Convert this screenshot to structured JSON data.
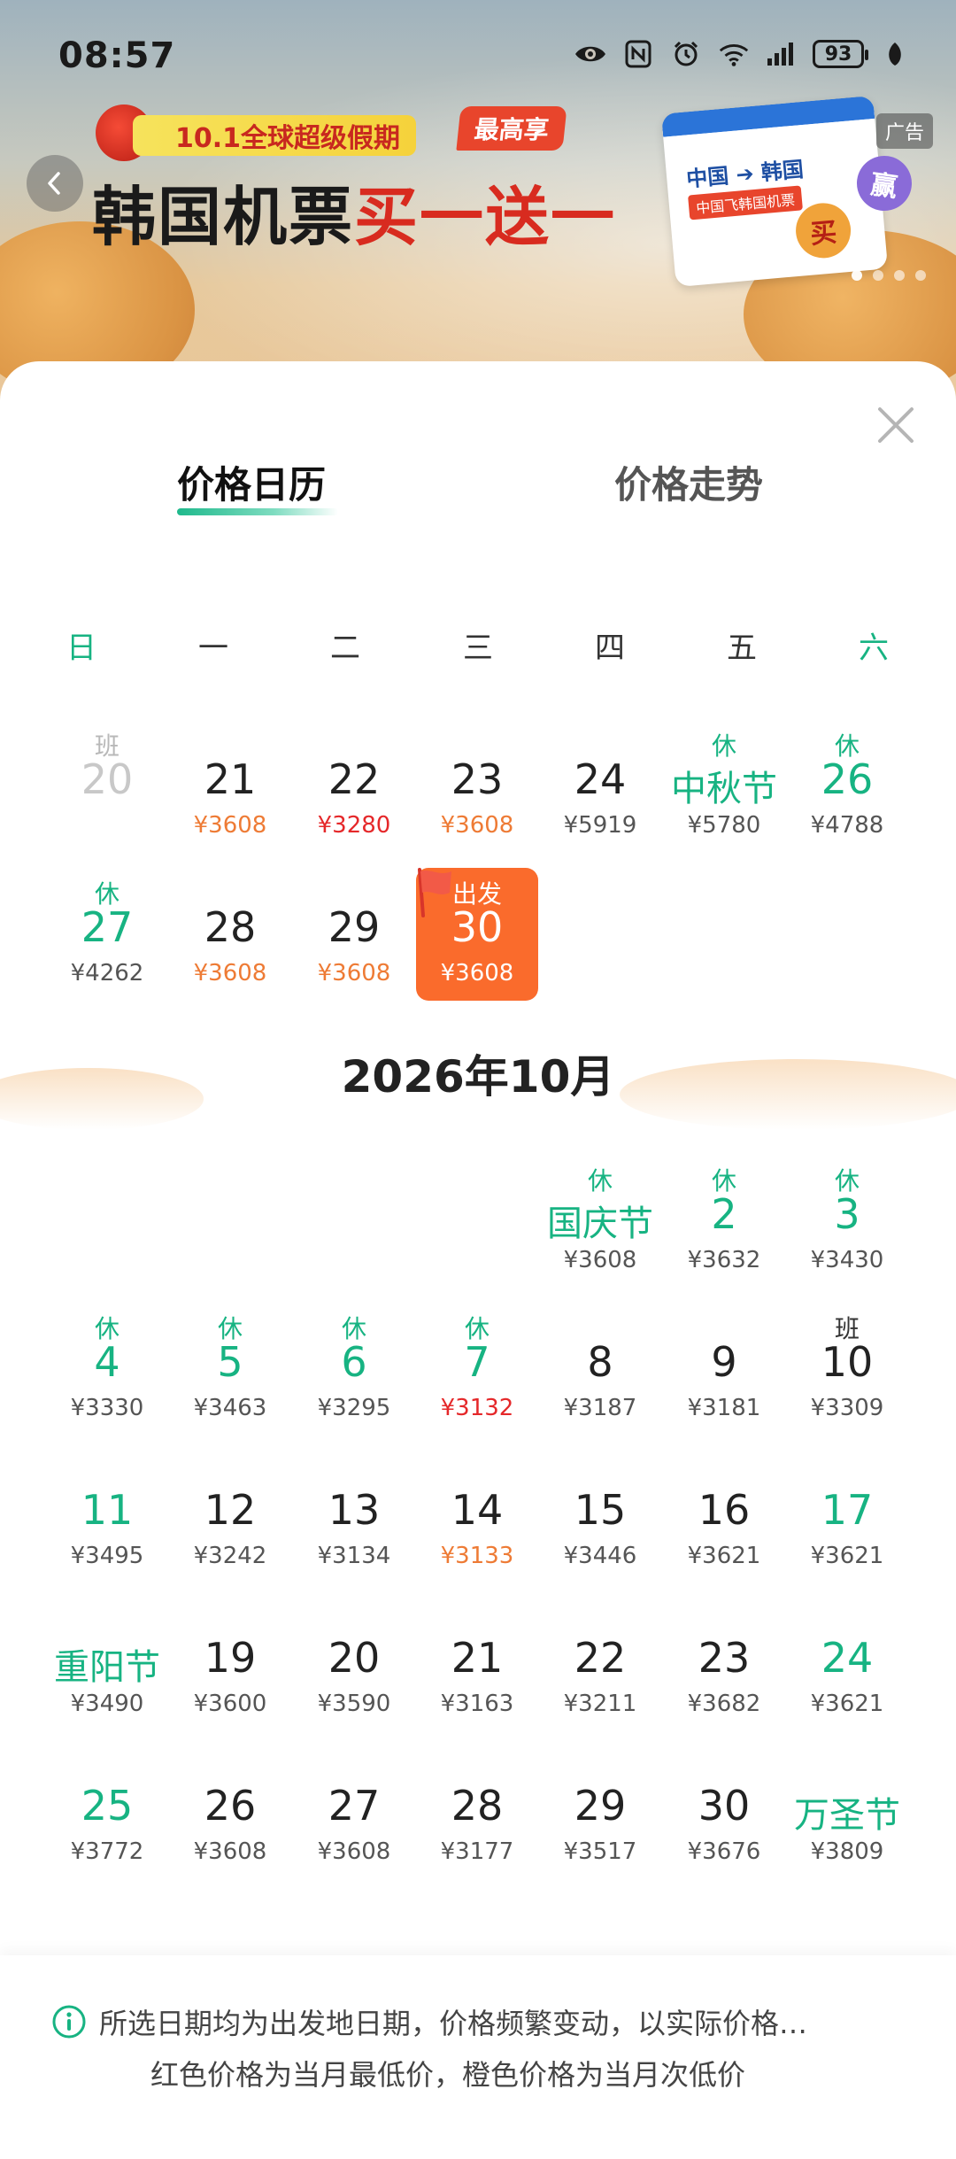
{
  "status_bar": {
    "time": "08:57",
    "battery": "93",
    "icons": [
      "eye-icon",
      "nfc-icon",
      "alarm-icon",
      "wifi-6-icon",
      "signal-icon",
      "leaf-icon"
    ]
  },
  "banner": {
    "promo_tag": "10.1全球超级假期",
    "title_black": "韩国机票",
    "title_red": "买一送一",
    "max_tag": "最高享",
    "ticket_route": "中国 ➔ 韩国",
    "ticket_sub": "中国飞韩国机票",
    "ticket_buy": "买",
    "ticket_win": "赢",
    "ad_label": "广告"
  },
  "tabs": {
    "calendar": "价格日历",
    "trend": "价格走势"
  },
  "weekdays": [
    "日",
    "一",
    "二",
    "三",
    "四",
    "五",
    "六"
  ],
  "september": [
    {
      "tag": "班",
      "day": "20",
      "price": ""
    },
    {
      "tag": "",
      "day": "21",
      "price": "¥3608"
    },
    {
      "tag": "",
      "day": "22",
      "price": "¥3280"
    },
    {
      "tag": "",
      "day": "23",
      "price": "¥3608"
    },
    {
      "tag": "",
      "day": "24",
      "price": "¥5919"
    },
    {
      "tag": "休",
      "day": "中秋节",
      "price": "¥5780"
    },
    {
      "tag": "休",
      "day": "26",
      "price": "¥4788"
    },
    {
      "tag": "休",
      "day": "27",
      "price": "¥4262"
    },
    {
      "tag": "",
      "day": "28",
      "price": "¥3608"
    },
    {
      "tag": "",
      "day": "29",
      "price": "¥3608"
    },
    {
      "tag": "出发",
      "day": "30",
      "price": "¥3608"
    }
  ],
  "october_title": "2026年10月",
  "october": [
    {
      "tag": "休",
      "day": "国庆节",
      "price": "¥3608"
    },
    {
      "tag": "休",
      "day": "2",
      "price": "¥3632"
    },
    {
      "tag": "休",
      "day": "3",
      "price": "¥3430"
    },
    {
      "tag": "休",
      "day": "4",
      "price": "¥3330"
    },
    {
      "tag": "休",
      "day": "5",
      "price": "¥3463"
    },
    {
      "tag": "休",
      "day": "6",
      "price": "¥3295"
    },
    {
      "tag": "休",
      "day": "7",
      "price": "¥3132"
    },
    {
      "tag": "",
      "day": "8",
      "price": "¥3187"
    },
    {
      "tag": "",
      "day": "9",
      "price": "¥3181"
    },
    {
      "tag": "班",
      "day": "10",
      "price": "¥3309"
    },
    {
      "tag": "",
      "day": "11",
      "price": "¥3495"
    },
    {
      "tag": "",
      "day": "12",
      "price": "¥3242"
    },
    {
      "tag": "",
      "day": "13",
      "price": "¥3134"
    },
    {
      "tag": "",
      "day": "14",
      "price": "¥3133"
    },
    {
      "tag": "",
      "day": "15",
      "price": "¥3446"
    },
    {
      "tag": "",
      "day": "16",
      "price": "¥3621"
    },
    {
      "tag": "",
      "day": "17",
      "price": "¥3621"
    },
    {
      "tag": "",
      "day": "重阳节",
      "price": "¥3490"
    },
    {
      "tag": "",
      "day": "19",
      "price": "¥3600"
    },
    {
      "tag": "",
      "day": "20",
      "price": "¥3590"
    },
    {
      "tag": "",
      "day": "21",
      "price": "¥3163"
    },
    {
      "tag": "",
      "day": "22",
      "price": "¥3211"
    },
    {
      "tag": "",
      "day": "23",
      "price": "¥3682"
    },
    {
      "tag": "",
      "day": "24",
      "price": "¥3621"
    },
    {
      "tag": "",
      "day": "25",
      "price": "¥3772"
    },
    {
      "tag": "",
      "day": "26",
      "price": "¥3608"
    },
    {
      "tag": "",
      "day": "27",
      "price": "¥3608"
    },
    {
      "tag": "",
      "day": "28",
      "price": "¥3177"
    },
    {
      "tag": "",
      "day": "29",
      "price": "¥3517"
    },
    {
      "tag": "",
      "day": "30",
      "price": "¥3676"
    },
    {
      "tag": "",
      "day": "万圣节",
      "price": "¥3809"
    }
  ],
  "footer": {
    "line1": "所选日期均为出发地日期，价格频繁变动，以实际价格…",
    "line2": "红色价格为当月最低价，橙色价格为当月次低价"
  },
  "colors": {
    "accent_green": "#17b382",
    "lowest_red": "#e5282a",
    "second_orange": "#ee7b35",
    "selected_orange": "#fa6b2c"
  }
}
